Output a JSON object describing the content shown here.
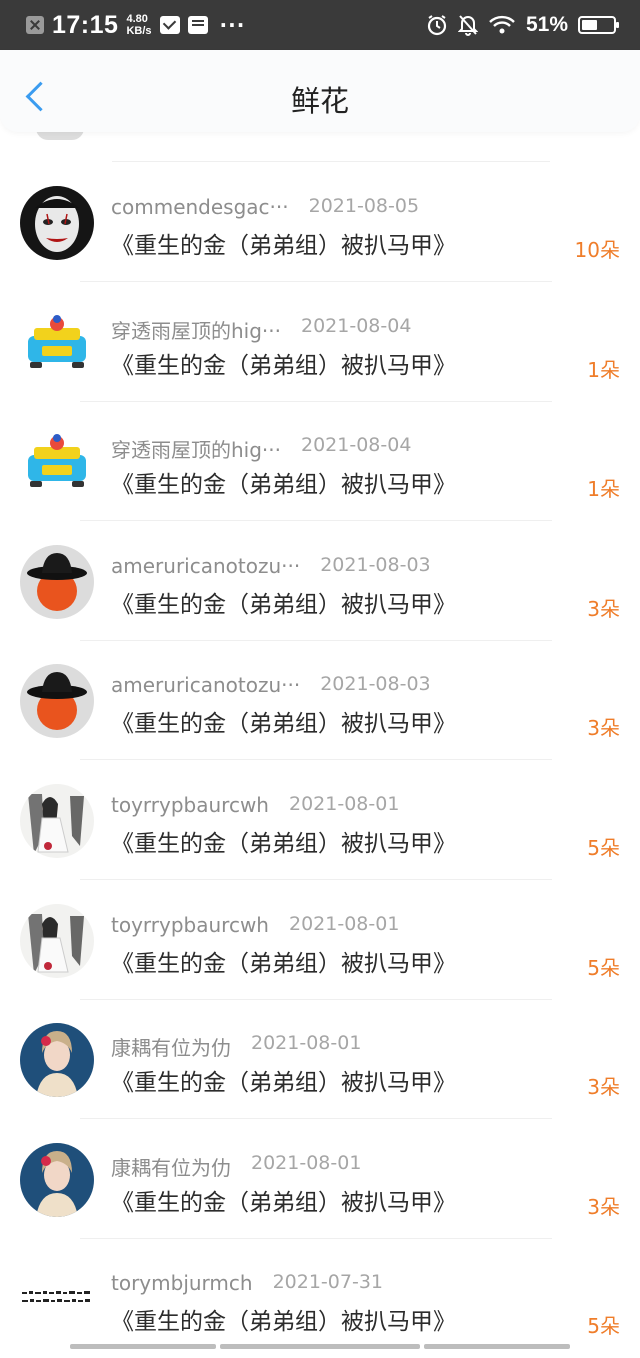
{
  "status_bar": {
    "time": "17:15",
    "speed_value": "4.80",
    "speed_unit": "KB/s",
    "more": "···",
    "battery_pct": "51%",
    "battery_level": 0.51
  },
  "header": {
    "title": "鲜花",
    "back_icon": "chevron-left-icon"
  },
  "list": [
    {
      "name": "commendesgac···",
      "date": "2021-08-05",
      "book": "《重生的金（弟弟组）被扒马甲》",
      "flowers": "10朵",
      "avatar": "clown-avatar"
    },
    {
      "name": "穿透雨屋顶的hig···",
      "date": "2021-08-04",
      "book": "《重生的金（弟弟组）被扒马甲》",
      "flowers": "1朵",
      "avatar": "toy-car-avatar"
    },
    {
      "name": "穿透雨屋顶的hig···",
      "date": "2021-08-04",
      "book": "《重生的金（弟弟组）被扒马甲》",
      "flowers": "1朵",
      "avatar": "toy-car-avatar"
    },
    {
      "name": "ameruricanotozu···",
      "date": "2021-08-03",
      "book": "《重生的金（弟弟组）被扒马甲》",
      "flowers": "3朵",
      "avatar": "orange-hat-avatar"
    },
    {
      "name": "ameruricanotozu···",
      "date": "2021-08-03",
      "book": "《重生的金（弟弟组）被扒马甲》",
      "flowers": "3朵",
      "avatar": "orange-hat-avatar"
    },
    {
      "name": "toyrrypbaurcwh",
      "date": "2021-08-01",
      "book": "《重生的金（弟弟组）被扒马甲》",
      "flowers": "5朵",
      "avatar": "anime-girl-avatar"
    },
    {
      "name": "toyrrypbaurcwh",
      "date": "2021-08-01",
      "book": "《重生的金（弟弟组）被扒马甲》",
      "flowers": "5朵",
      "avatar": "anime-girl-avatar"
    },
    {
      "name": "康耦有位为仂",
      "date": "2021-08-01",
      "book": "《重生的金（弟弟组）被扒马甲》",
      "flowers": "3朵",
      "avatar": "woman-portrait-avatar"
    },
    {
      "name": "康耦有位为仂",
      "date": "2021-08-01",
      "book": "《重生的金（弟弟组）被扒马甲》",
      "flowers": "3朵",
      "avatar": "woman-portrait-avatar"
    },
    {
      "name": "torymbjurmch",
      "date": "2021-07-31",
      "book": "《重生的金（弟弟组）被扒马甲》",
      "flowers": "5朵",
      "avatar": "calligraphy-avatar"
    }
  ],
  "colors": {
    "accent": "#3a9cf0",
    "flowers": "#ef7d2a",
    "status_bar": "#3a3a3a"
  }
}
